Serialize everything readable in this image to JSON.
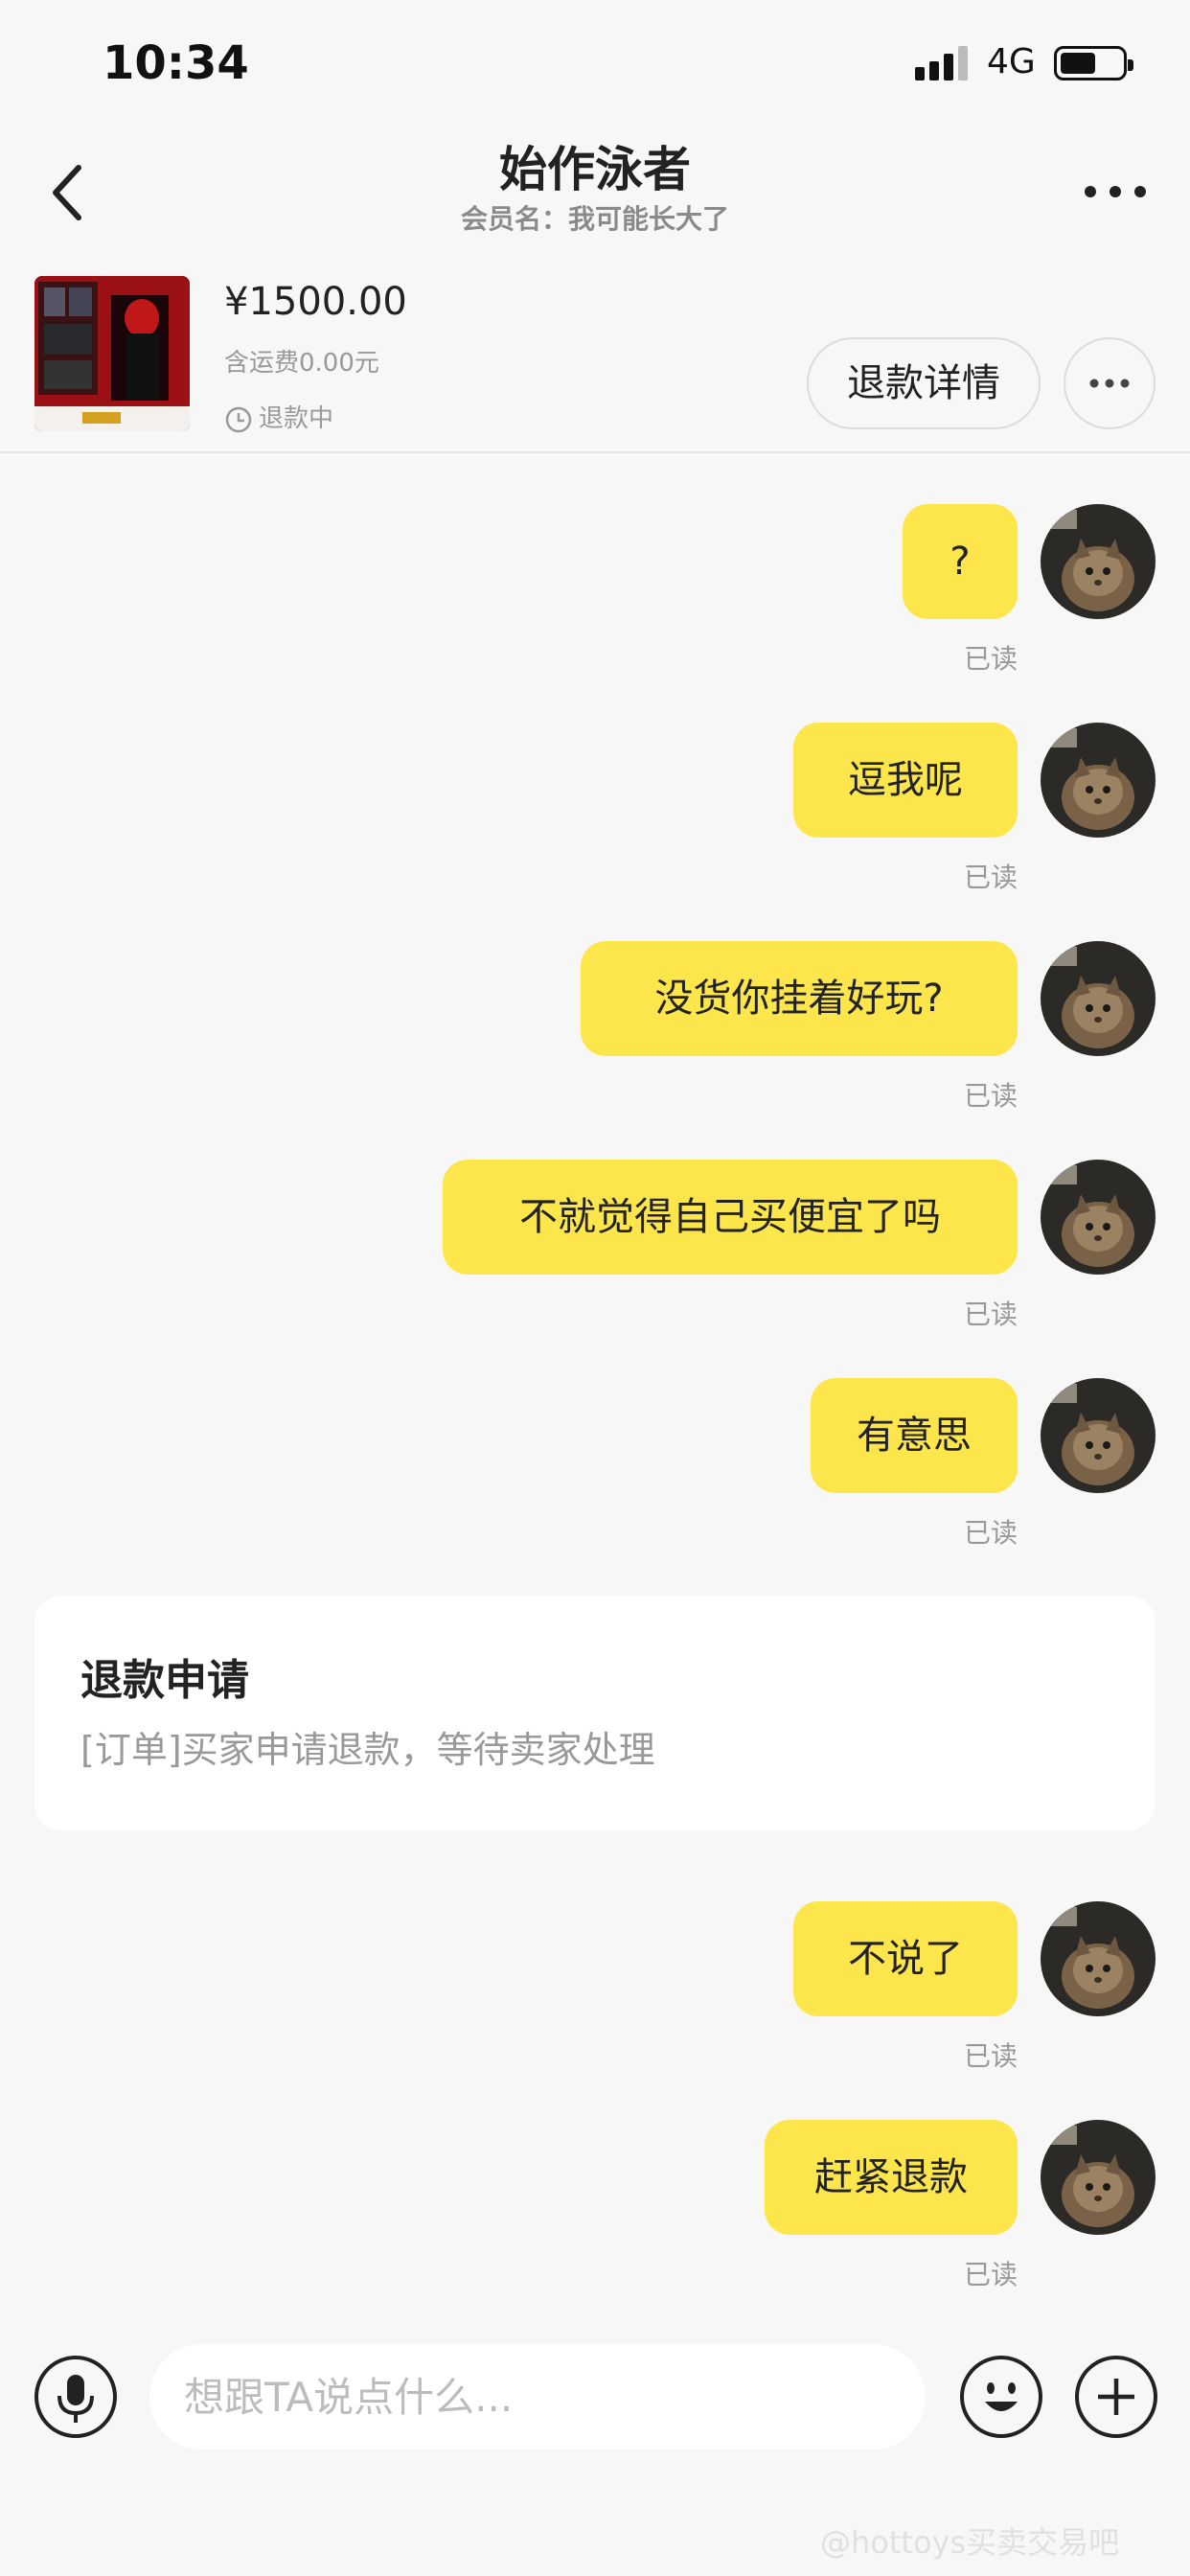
{
  "status_bar": {
    "time": "10:34",
    "network": "4G"
  },
  "header": {
    "title": "始作泳者",
    "subtitle": "会员名：我可能长大了"
  },
  "product": {
    "price": "¥1500.00",
    "shipping": "含运费0.00元",
    "status": "退款中",
    "detail_button": "退款详情"
  },
  "messages": [
    {
      "text": "?",
      "read": "已读"
    },
    {
      "text": "逗我呢",
      "read": "已读"
    },
    {
      "text": "没货你挂着好玩?",
      "read": "已读"
    },
    {
      "text": "不就觉得自己买便宜了吗",
      "read": "已读"
    },
    {
      "text": "有意思",
      "read": "已读"
    },
    {
      "text": "不说了",
      "read": "已读"
    },
    {
      "text": "赶紧退款",
      "read": "已读"
    }
  ],
  "refund_card": {
    "title": "退款申请",
    "desc": "[订单]买家申请退款，等待卖家处理"
  },
  "input": {
    "placeholder": "想跟TA说点什么..."
  },
  "watermark": "@hottoys买卖交易吧",
  "colors": {
    "bubble": "#fde64b",
    "background": "#f7f7f7"
  },
  "icons": [
    "back-icon",
    "more-icon",
    "clock-icon",
    "microphone-icon",
    "emoji-icon",
    "plus-icon"
  ]
}
